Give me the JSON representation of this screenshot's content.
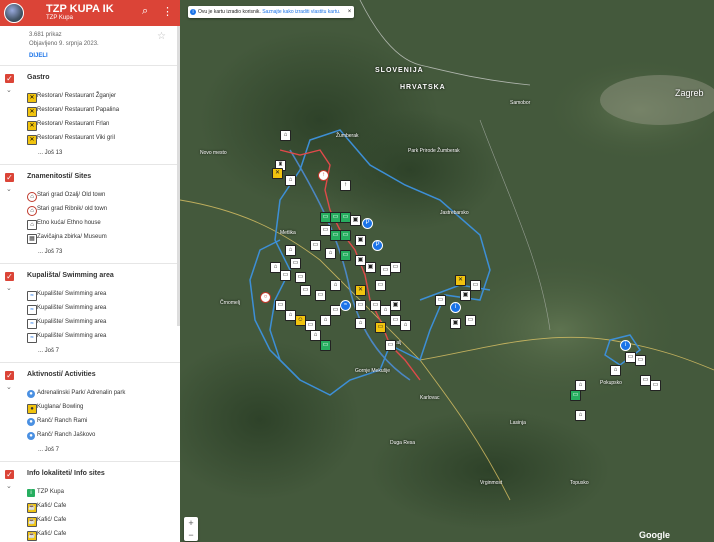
{
  "app": {
    "title": "TZP KUPA IK",
    "subtitle": "TZP Kupa",
    "views": "3.681 prikaz",
    "published": "Objavljeno 9. srpnja 2023.",
    "share_label": "DIJELI"
  },
  "layers": [
    {
      "title": "Gastro",
      "items": [
        {
          "label": "Restoran/ Restaurant Žganjer",
          "icon": "fork-knife-icon"
        },
        {
          "label": "Restoran/ Restaurant Papalina",
          "icon": "fork-knife-icon"
        },
        {
          "label": "Restoran/ Restaurant Frlan",
          "icon": "fork-knife-icon"
        },
        {
          "label": "Restoran/ Restaurant Viki gril",
          "icon": "fork-knife-icon"
        }
      ],
      "more": "... Još 13"
    },
    {
      "title": "Znamenitosti/ Sites",
      "items": [
        {
          "label": "Stari grad Ozalj/ Old town",
          "icon": "castle-icon"
        },
        {
          "label": "Stari grad Ribnik/ old town",
          "icon": "castle-icon"
        },
        {
          "label": "Etno kuća/ Ethno house",
          "icon": "house-icon"
        },
        {
          "label": "Zavičajna zbirka/ Museum",
          "icon": "museum-icon"
        }
      ],
      "more": "... Još 73"
    },
    {
      "title": "Kupališta/ Swimming area",
      "items": [
        {
          "label": "Kupalište/ Swimming area",
          "icon": "swimming-icon"
        },
        {
          "label": "Kupalište/ Swimming area",
          "icon": "swimming-icon"
        },
        {
          "label": "Kupalište/ Swimming area",
          "icon": "swimming-icon"
        },
        {
          "label": "Kupalište/ Swimming area",
          "icon": "swimming-icon"
        }
      ],
      "more": "... Još 7"
    },
    {
      "title": "Aktivnosti/ Activities",
      "items": [
        {
          "label": "Adrenalinski Park/ Adrenalin park",
          "icon": "activity-icon"
        },
        {
          "label": "Kuglana/ Bowling",
          "icon": "bowling-icon"
        },
        {
          "label": "Ranč/ Ranch Rami",
          "icon": "activity-icon"
        },
        {
          "label": "Ranč/ Ranch Jaškovo",
          "icon": "activity-icon"
        }
      ],
      "more": "... Još 7"
    },
    {
      "title": "Info lokaliteti/ Info sites",
      "items": [
        {
          "label": "TZP Kupa",
          "icon": "info-icon"
        },
        {
          "label": "Kafić/ Cafe",
          "icon": "cafe-icon"
        },
        {
          "label": "Kafić/ Cafe",
          "icon": "cafe-icon"
        },
        {
          "label": "Kafić/ Cafe",
          "icon": "cafe-icon"
        }
      ],
      "more": ""
    }
  ],
  "map": {
    "notice_text": "Ovu je kartu izradio korisnik.",
    "notice_link": "Saznajte kako izraditi vlastitu kartu.",
    "labels": {
      "slovenija": "SLOVENIJA",
      "hrvatska": "HRVATSKA",
      "zagreb": "Zagreb",
      "zumberak": "Žumberak",
      "park": "Park Prirode Žumberak",
      "ozalj": "Ozalj",
      "karlovac": "Karlovac",
      "duga_resa": "Duga Resa",
      "pokupsko": "Pokupsko",
      "jastrebarsko": "Jastrebarsko",
      "samobor": "Samobor",
      "metlika": "Metlika",
      "crnomelj": "Črnomelj",
      "novo_mesto": "Novo mesto",
      "gornje_mekusje": "Gornje Mekušje",
      "lasinja": "Lasinja",
      "topusko": "Topusko",
      "vrginmost": "Vrginmost"
    },
    "zoom_in": "+",
    "zoom_out": "−",
    "google": "Google"
  },
  "colors": {
    "accent": "#db4437",
    "route_blue": "#3d8fd6",
    "route_red": "#e04a4a",
    "map_base": "#3f5437"
  }
}
